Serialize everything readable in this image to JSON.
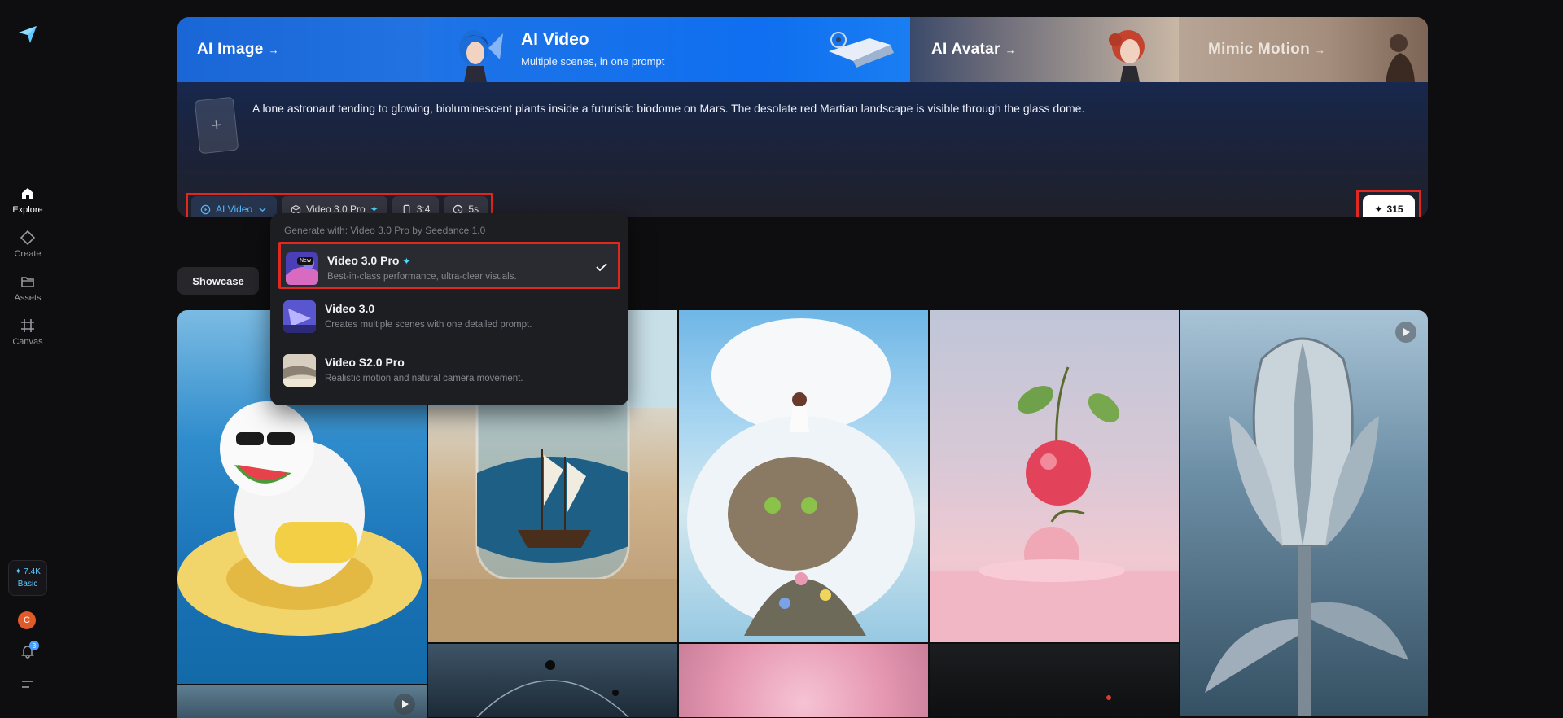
{
  "sidebar": {
    "logo": "paper-plane-logo",
    "items": [
      {
        "label": "Explore",
        "icon": "home-icon",
        "active": true
      },
      {
        "label": "Create",
        "icon": "diamond-icon",
        "active": false
      },
      {
        "label": "Assets",
        "icon": "folder-icon",
        "active": false
      },
      {
        "label": "Canvas",
        "icon": "canvas-icon",
        "active": false
      }
    ],
    "credits": "7.4K",
    "plan": "Basic",
    "avatar_initial": "C",
    "notification_count": "3"
  },
  "hero": {
    "tabs": {
      "image": "AI Image",
      "video_title": "AI Video",
      "video_subtitle": "Multiple scenes, in one prompt",
      "avatar": "AI Avatar",
      "mimic": "Mimic Motion"
    },
    "arrow": "→",
    "upload_icon": "+",
    "prompt": "A lone astronaut tending to glowing, bioluminescent plants inside a futuristic biodome on Mars. The desolate red Martian landscape is visible through the glass dome.",
    "toolbar": {
      "mode": "AI Video",
      "model": "Video 3.0 Pro",
      "ratio": "3:4",
      "duration": "5s"
    },
    "generate_cost": "315"
  },
  "showcase_label": "Showcase",
  "dropdown": {
    "header": "Generate with: Video 3.0 Pro by Seedance 1.0",
    "items": [
      {
        "name": "Video 3.0 Pro",
        "desc": "Best-in-class performance, ultra-clear visuals.",
        "badge": "New",
        "selected": true
      },
      {
        "name": "Video 3.0",
        "desc": "Creates multiple scenes with one detailed prompt.",
        "selected": false
      },
      {
        "name": "Video S2.0 Pro",
        "desc": "Realistic motion and natural camera movement.",
        "selected": false
      }
    ]
  },
  "colors": {
    "accent": "#4fb7ff",
    "highlight": "#e0281e",
    "background": "#0e0e10"
  }
}
